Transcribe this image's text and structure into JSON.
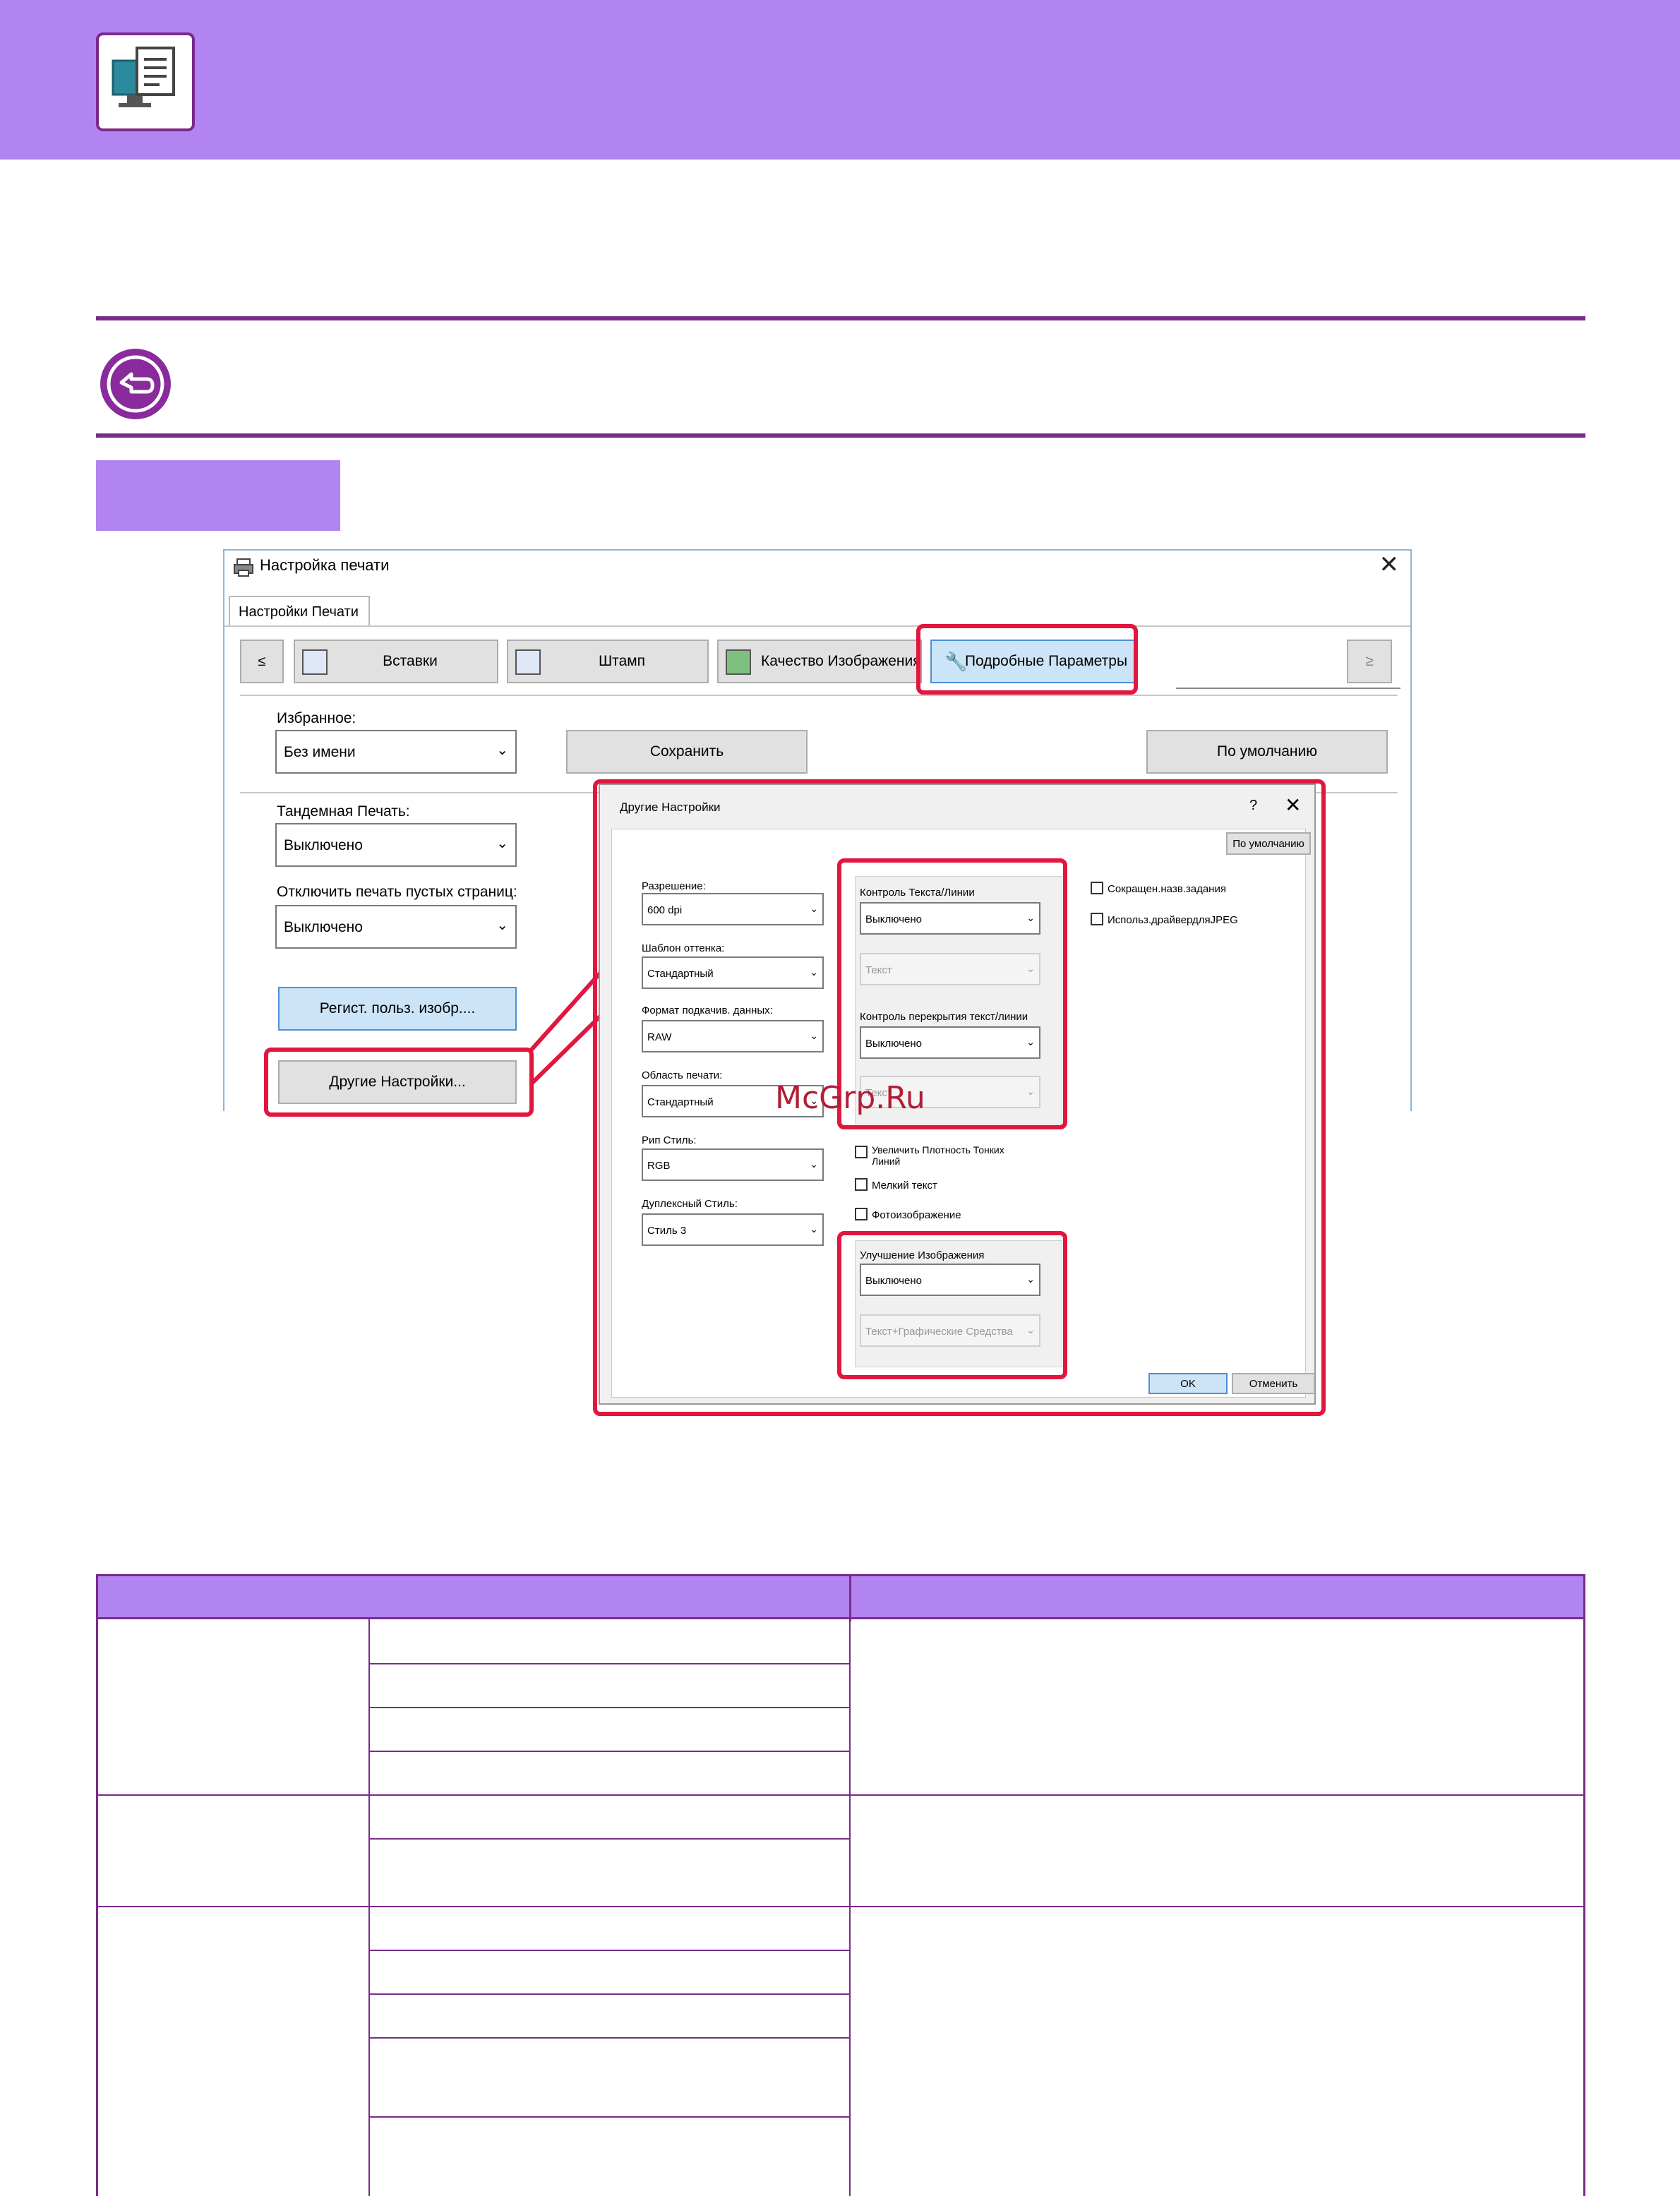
{
  "window": {
    "title": "Настройка печати",
    "tab": "Настройки Печати",
    "nav_prev": "≤",
    "nav_next": "≥",
    "toolbar_tabs": [
      "Вставки",
      "Штамп",
      "Качество Изображения",
      "Подробные Параметры"
    ],
    "favorites": {
      "label": "Избранное:",
      "value": "Без имени",
      "save_button": "Сохранить",
      "default_button": "По умолчанию"
    },
    "tandem": {
      "label": "Тандемная Печать:",
      "value": "Выключено"
    },
    "blank_pages": {
      "label": "Отключить печать пустых страниц:",
      "value": "Выключено"
    },
    "register_button": "Регист. польз. изобр....",
    "other_settings_button": "Другие Настройки..."
  },
  "sub_dialog": {
    "title": "Другие Настройки",
    "help": "?",
    "default_button": "По умолчанию",
    "resolution": {
      "label": "Разрешение:",
      "value": "600 dpi"
    },
    "halftone": {
      "label": "Шаблон оттенка:",
      "value": "Стандартный"
    },
    "spool_format": {
      "label": "Формат подкачив. данных:",
      "value": "RAW"
    },
    "print_area": {
      "label": "Область печати:",
      "value": "Стандартный"
    },
    "rip_style": {
      "label": "Рип Стиль:",
      "value": "RGB"
    },
    "duplex_style": {
      "label": "Дуплексный Стиль:",
      "value": "Стиль 3"
    },
    "text_line_control": {
      "label": "Контроль Текста/Линии",
      "value": "Выключено",
      "sub_value": "Текст"
    },
    "overlap_control": {
      "label": "Контроль перекрытия текст/линии",
      "value": "Выключено",
      "sub_value": "Текст"
    },
    "checkboxes_mid": [
      "Увеличить Плотность Тонких Линий",
      "Мелкий текст",
      "Фотоизображение"
    ],
    "checkboxes_right": [
      "Сокращен.назв.задания",
      "Использ.драйвердляJPEG"
    ],
    "image_enhance": {
      "label": "Улучшение Изображения",
      "value": "Выключено",
      "sub_value": "Текст+Графические Средства"
    },
    "ok": "OK",
    "cancel": "Отменить"
  },
  "watermark": "McGrp.Ru"
}
